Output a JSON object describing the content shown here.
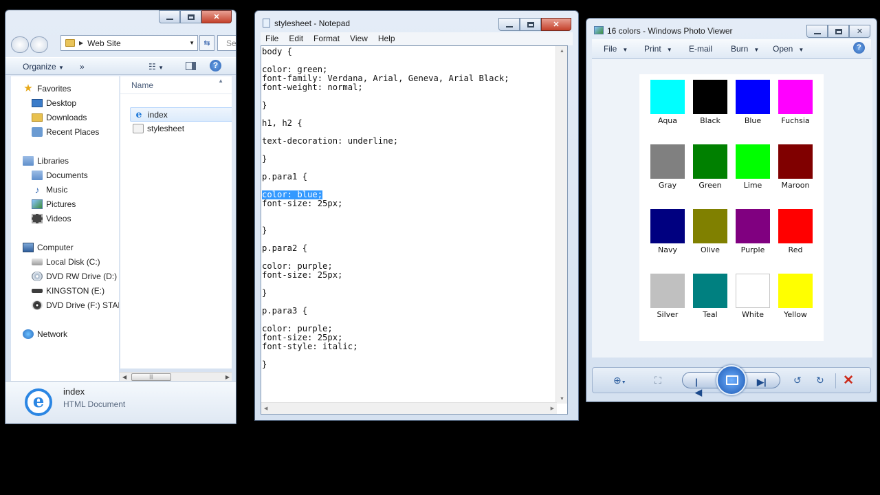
{
  "explorer": {
    "address": "Web Site",
    "search_placeholder": "Se",
    "organize_label": "Organize",
    "more_label": "»",
    "nav": {
      "favorites": "Favorites",
      "desktop": "Desktop",
      "downloads": "Downloads",
      "recent": "Recent Places",
      "libraries": "Libraries",
      "documents": "Documents",
      "music": "Music",
      "pictures": "Pictures",
      "videos": "Videos",
      "computer": "Computer",
      "local_disk": "Local Disk (C:)",
      "dvd_rw": "DVD RW Drive (D:) N",
      "kingston": "KINGSTON (E:)",
      "dvd_f": "DVD Drive (F:) STAR",
      "network": "Network"
    },
    "column_name": "Name",
    "files": [
      {
        "name": "index"
      },
      {
        "name": "stylesheet"
      }
    ],
    "details": {
      "name": "index",
      "type": "HTML Document"
    }
  },
  "notepad": {
    "title": "stylesheet - Notepad",
    "menu": [
      "File",
      "Edit",
      "Format",
      "View",
      "Help"
    ],
    "highlighted": "color: blue;",
    "lines": [
      "body {",
      "",
      "color: green;",
      "font-family: Verdana, Arial, Geneva, Arial Black;",
      "font-weight: normal;",
      "",
      "}",
      "",
      "h1, h2 {",
      "",
      "text-decoration: underline;",
      "",
      "}",
      "",
      "p.para1 {",
      "",
      "",
      "font-size: 25px;",
      "",
      "",
      "}",
      "",
      "p.para2 {",
      "",
      "color: purple;",
      "font-size: 25px;",
      "",
      "}",
      "",
      "p.para3 {",
      "",
      "color: purple;",
      "font-size: 25px;",
      "font-style: italic;",
      "",
      "}"
    ]
  },
  "viewer": {
    "title": "16 colors - Windows Photo Viewer",
    "menu": {
      "file": "File",
      "print": "Print",
      "email": "E-mail",
      "burn": "Burn",
      "open": "Open"
    },
    "help": "?",
    "swatches": [
      {
        "label": "Aqua",
        "color": "#00ffff"
      },
      {
        "label": "Black",
        "color": "#000000"
      },
      {
        "label": "Blue",
        "color": "#0000ff"
      },
      {
        "label": "Fuchsia",
        "color": "#ff00ff"
      },
      {
        "label": "Gray",
        "color": "#808080"
      },
      {
        "label": "Green",
        "color": "#008000"
      },
      {
        "label": "Lime",
        "color": "#00ff00"
      },
      {
        "label": "Maroon",
        "color": "#800000"
      },
      {
        "label": "Navy",
        "color": "#000080"
      },
      {
        "label": "Olive",
        "color": "#808000"
      },
      {
        "label": "Purple",
        "color": "#800080"
      },
      {
        "label": "Red",
        "color": "#ff0000"
      },
      {
        "label": "Silver",
        "color": "#c0c0c0"
      },
      {
        "label": "Teal",
        "color": "#008080"
      },
      {
        "label": "White",
        "color": "#ffffff"
      },
      {
        "label": "Yellow",
        "color": "#ffff00"
      }
    ]
  }
}
